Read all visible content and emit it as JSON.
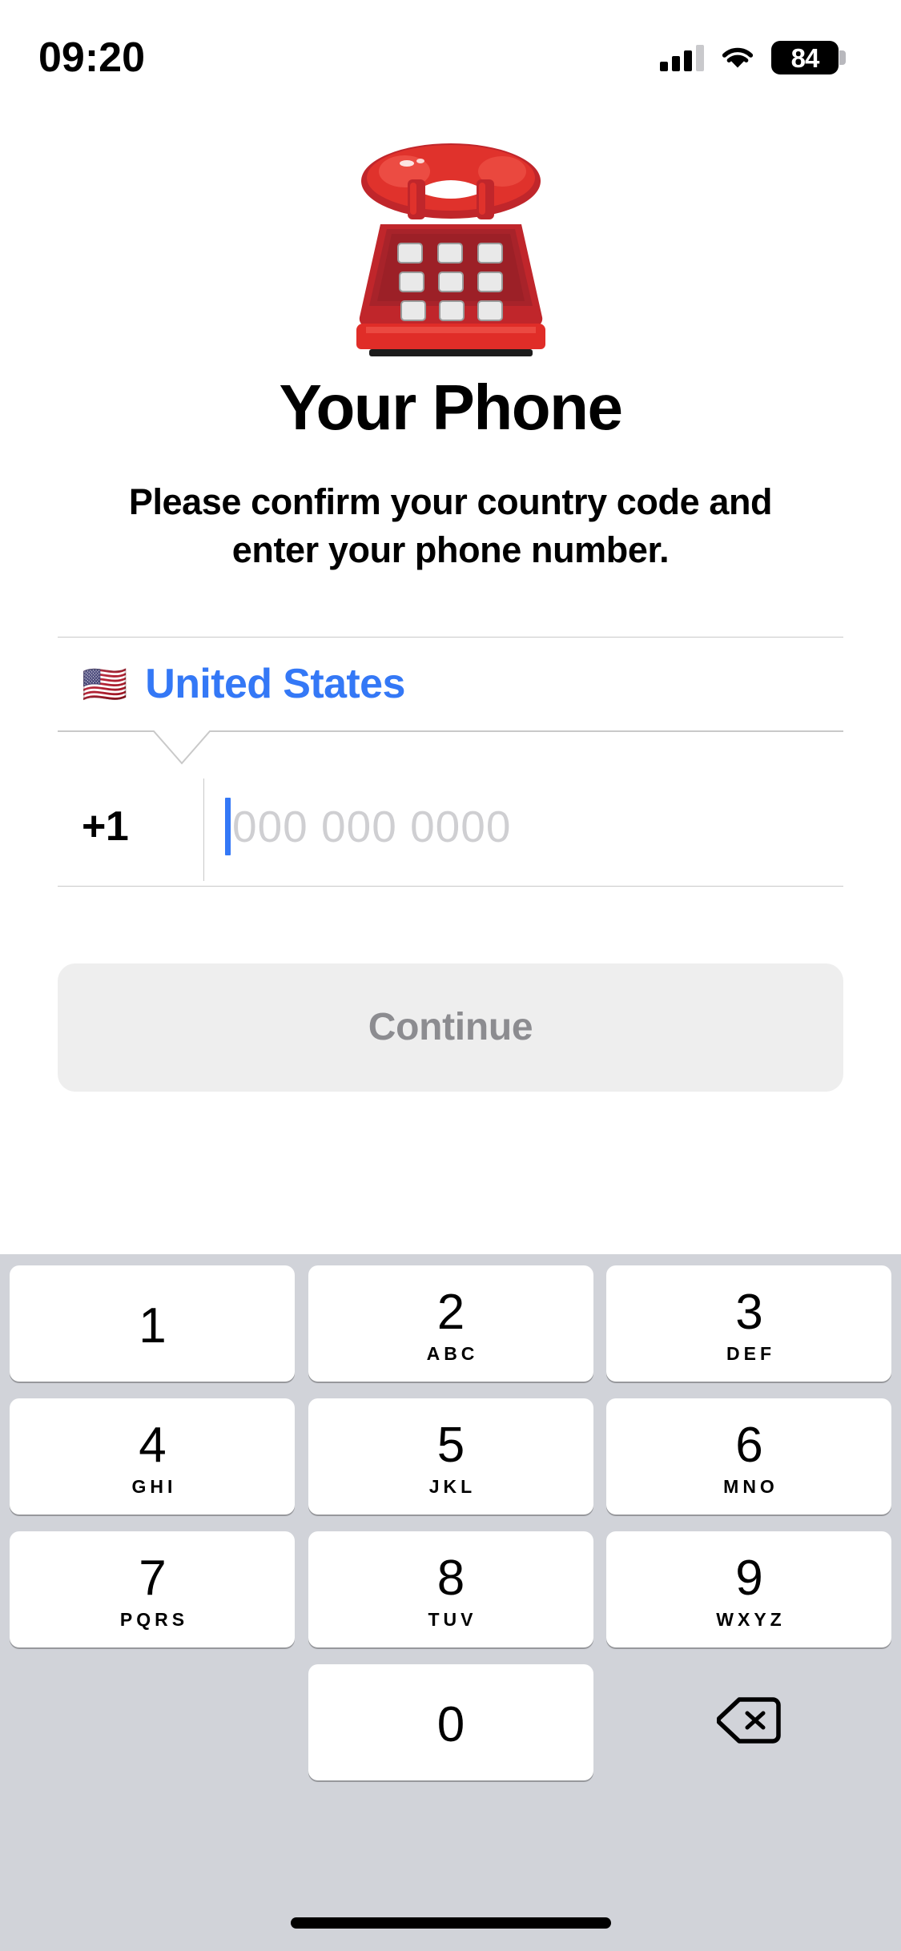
{
  "status_bar": {
    "time": "09:20",
    "battery_percent": "84",
    "signal_icon": "cellular-signal-icon",
    "wifi_icon": "wifi-icon",
    "battery_icon": "battery-icon"
  },
  "hero": {
    "emoji": "telephone-emoji",
    "emoji_glyph": "☎️"
  },
  "header": {
    "title": "Your Phone",
    "subtitle": "Please confirm your country code and enter your phone number."
  },
  "form": {
    "country": {
      "flag": "🇺🇸",
      "name": "United States",
      "name_color": "#3478F6"
    },
    "dial_code": "+1",
    "phone_placeholder": "000 000 0000",
    "phone_value": "",
    "caret_color": "#3478F6"
  },
  "actions": {
    "continue_label": "Continue",
    "continue_enabled": false,
    "continue_bg": "#EEEEEE",
    "continue_text_color": "#8C8C90"
  },
  "keypad": {
    "background": "#D1D3D9",
    "rows": [
      [
        {
          "digit": "1",
          "letters": ""
        },
        {
          "digit": "2",
          "letters": "ABC"
        },
        {
          "digit": "3",
          "letters": "DEF"
        }
      ],
      [
        {
          "digit": "4",
          "letters": "GHI"
        },
        {
          "digit": "5",
          "letters": "JKL"
        },
        {
          "digit": "6",
          "letters": "MNO"
        }
      ],
      [
        {
          "digit": "7",
          "letters": "PQRS"
        },
        {
          "digit": "8",
          "letters": "TUV"
        },
        {
          "digit": "9",
          "letters": "WXYZ"
        }
      ]
    ],
    "zero_key": {
      "digit": "0",
      "letters": ""
    },
    "delete_icon": "backspace-delete-icon"
  }
}
